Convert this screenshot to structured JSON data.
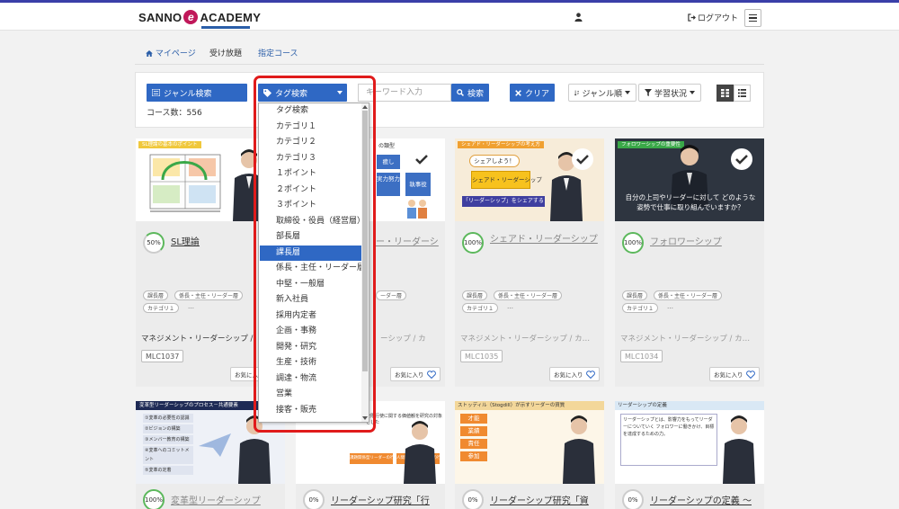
{
  "brand": {
    "pre": "SANNO",
    "e": "e",
    "post": "ACADEMY"
  },
  "header": {
    "logout": "ログアウト"
  },
  "tabs": [
    {
      "label": "マイページ"
    },
    {
      "label": "受け放題"
    },
    {
      "label": "指定コース"
    }
  ],
  "filters": {
    "genre_search": "ジャンル検索",
    "tag_search": "タグ検索",
    "keyword_placeholder": "キーワード入力",
    "search": "検索",
    "clear": "クリア",
    "sort": "ジャンル順",
    "status": "学習状況",
    "course_count": "コース数：556"
  },
  "dropdown": {
    "items": [
      "タグ検索",
      "カテゴリ１",
      "カテゴリ２",
      "カテゴリ３",
      "１ポイント",
      "２ポイント",
      "３ポイント",
      "取締役・役員（経営層）",
      "部長層",
      "課長層",
      "係長・主任・リーダー層",
      "中堅・一般層",
      "新入社員",
      "採用内定者",
      "企画・事務",
      "開発・研究",
      "生産・技術",
      "調達・物流",
      "営業",
      "接客・販売"
    ],
    "selected": "課長層"
  },
  "cards": [
    {
      "progress": "50%",
      "title": "SL理論",
      "thumb_heading": "SL理論の基本のポイント",
      "tags": [
        "課長層",
        "係長・主任・リーダー層",
        "カテゴリ１"
      ],
      "more": "…",
      "category": "マネジメント・リーダーシップ /",
      "code": "MLC1037",
      "fav": "お気に入り"
    },
    {
      "progress": "",
      "title": "ー・リーダーシ",
      "thumb_heading": "の類型",
      "thumb_words": [
        "癒し",
        "実力努力",
        "執事役"
      ],
      "tags": [
        "ーダー層"
      ],
      "category": "ーシップ / カ",
      "code": "",
      "fav": "お気に入り"
    },
    {
      "progress": "100%",
      "title": "シェアド・リーダーシップ",
      "thumb_heading": "シェアド・リーダーシップの考え方",
      "thumb_bubble": "シェアしよう！",
      "thumb_sign": "シェアド・リーダーシップ",
      "thumb_caption": "「リーダーシップ」をシェアする",
      "tags": [
        "課長層",
        "係長・主任・リーダー層",
        "カテゴリ１"
      ],
      "category": "マネジメント・リーダーシップ / カ…",
      "code": "MLC1035",
      "fav": "お気に入り"
    },
    {
      "progress": "100%",
      "title": "フォロワーシップ",
      "thumb_heading": "フォロワーシップの重要性",
      "thumb_caption": "自分の上司やリーダーに対して どのような姿勢で仕事に取り組んでいますか？",
      "tags": [
        "課長層",
        "係長・主任・リーダー層",
        "カテゴリ１"
      ],
      "category": "マネジメント・リーダーシップ / カ…",
      "code": "MLC1034",
      "fav": "お気に入り"
    },
    {
      "progress": "100%",
      "title": "変革型リーダーシップ",
      "thumb_heading": "変革型リーダーシップのプロセス－共通要素",
      "thumb_list": [
        "①変革の必要性の認識",
        "②ビジョンの構築",
        "③メンバー教育の構築",
        "④変革へのコミットメント",
        "⑤変革の定着"
      ]
    },
    {
      "progress": "0%",
      "title": "リーダーシップ研究「行",
      "thumb_heading": "権限行使に関する価値観を研究の対象とした",
      "thumb_boxes": [
        "課題関係型リーダーの行動",
        "人間関係型リーダーの行動"
      ]
    },
    {
      "progress": "0%",
      "title": "リーダーシップ研究「資",
      "thumb_heading": "ストッディル（Stogdill）が示すリーダーの資質",
      "thumb_traits": [
        "才能",
        "業績",
        "責任",
        "参加"
      ]
    },
    {
      "progress": "0%",
      "title": "リーダーシップの定義 ～",
      "thumb_heading": "リーダーシップの定義",
      "thumb_text": "リーダーシップとは、影響力をもってリーダーについていく フォロワーに働きかけ、目標を達成するための力。"
    }
  ],
  "colors": {
    "accent": "#2f68c4",
    "highlight": "#e01b1b",
    "progress": "#5cb85c"
  }
}
